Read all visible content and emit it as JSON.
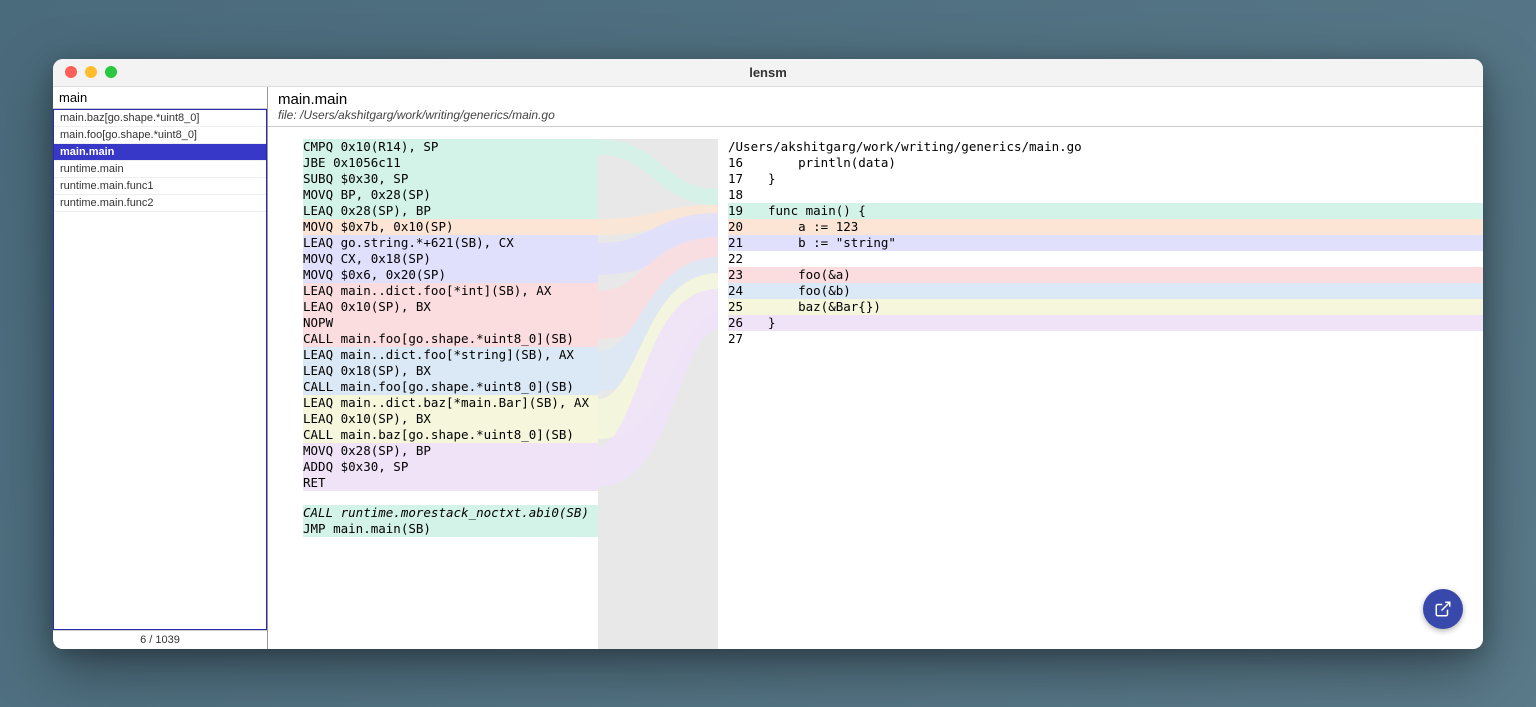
{
  "window": {
    "title": "lensm"
  },
  "sidebar": {
    "search_value": "main",
    "items": [
      {
        "label": "main.baz[go.shape.*uint8_0]",
        "selected": false
      },
      {
        "label": "main.foo[go.shape.*uint8_0]",
        "selected": false
      },
      {
        "label": "main.main",
        "selected": true
      },
      {
        "label": "runtime.main",
        "selected": false
      },
      {
        "label": "runtime.main.func1",
        "selected": false
      },
      {
        "label": "runtime.main.func2",
        "selected": false
      }
    ],
    "footer": "6 / 1039"
  },
  "header": {
    "title": "main.main",
    "file_prefix": "file: ",
    "file_path": "/Users/akshitgarg/work/writing/generics/main.go"
  },
  "asm": {
    "blocks": [
      [
        {
          "text": "CMPQ 0x10(R14), SP",
          "hl": "hl-teal"
        },
        {
          "text": "JBE 0x1056c11",
          "hl": "hl-teal"
        },
        {
          "text": "SUBQ $0x30, SP",
          "hl": "hl-teal"
        },
        {
          "text": "MOVQ BP, 0x28(SP)",
          "hl": "hl-teal"
        },
        {
          "text": "LEAQ 0x28(SP), BP",
          "hl": "hl-teal"
        },
        {
          "text": "MOVQ $0x7b, 0x10(SP)",
          "hl": "hl-orange"
        },
        {
          "text": "LEAQ go.string.*+621(SB), CX",
          "hl": "hl-purple"
        },
        {
          "text": "MOVQ CX, 0x18(SP)",
          "hl": "hl-purple"
        },
        {
          "text": "MOVQ $0x6, 0x20(SP)",
          "hl": "hl-purple"
        },
        {
          "text": "LEAQ main..dict.foo[*int](SB), AX",
          "hl": "hl-red"
        },
        {
          "text": "LEAQ 0x10(SP), BX",
          "hl": "hl-red"
        },
        {
          "text": "NOPW",
          "hl": "hl-red"
        },
        {
          "text": "CALL main.foo[go.shape.*uint8_0](SB)",
          "hl": "hl-red"
        },
        {
          "text": "LEAQ main..dict.foo[*string](SB), AX",
          "hl": "hl-blue"
        },
        {
          "text": "LEAQ 0x18(SP), BX",
          "hl": "hl-blue"
        },
        {
          "text": "CALL main.foo[go.shape.*uint8_0](SB)",
          "hl": "hl-blue"
        },
        {
          "text": "LEAQ main..dict.baz[*main.Bar](SB), AX",
          "hl": "hl-yellow"
        },
        {
          "text": "LEAQ 0x10(SP), BX",
          "hl": "hl-yellow"
        },
        {
          "text": "CALL main.baz[go.shape.*uint8_0](SB)",
          "hl": "hl-yellow"
        },
        {
          "text": "MOVQ 0x28(SP), BP",
          "hl": "hl-lilac"
        },
        {
          "text": "ADDQ $0x30, SP",
          "hl": "hl-lilac"
        },
        {
          "text": "RET",
          "hl": "hl-lilac"
        }
      ],
      [
        {
          "text": "CALL runtime.morestack_noctxt.abi0(SB)",
          "hl": "hl-teal",
          "italic": true
        },
        {
          "text": "JMP main.main(SB)",
          "hl": "hl-teal"
        }
      ]
    ]
  },
  "source": {
    "path": "/Users/akshitgarg/work/writing/generics/main.go",
    "lines": [
      {
        "num": "16",
        "text": "    println(data)",
        "hl": ""
      },
      {
        "num": "17",
        "text": "}",
        "hl": ""
      },
      {
        "num": "18",
        "text": "",
        "hl": ""
      },
      {
        "num": "19",
        "text": "func main() {",
        "hl": "hl-teal"
      },
      {
        "num": "20",
        "text": "    a := 123",
        "hl": "hl-orange"
      },
      {
        "num": "21",
        "text": "    b := \"string\"",
        "hl": "hl-purple"
      },
      {
        "num": "22",
        "text": "",
        "hl": ""
      },
      {
        "num": "23",
        "text": "    foo(&a)",
        "hl": "hl-red"
      },
      {
        "num": "24",
        "text": "    foo(&b)",
        "hl": "hl-blue"
      },
      {
        "num": "25",
        "text": "    baz(&Bar{})",
        "hl": "hl-yellow"
      },
      {
        "num": "26",
        "text": "}",
        "hl": "hl-lilac"
      },
      {
        "num": "27",
        "text": "",
        "hl": ""
      }
    ]
  },
  "colors": {
    "accent": "#3838c8",
    "fab": "#3949ab"
  }
}
